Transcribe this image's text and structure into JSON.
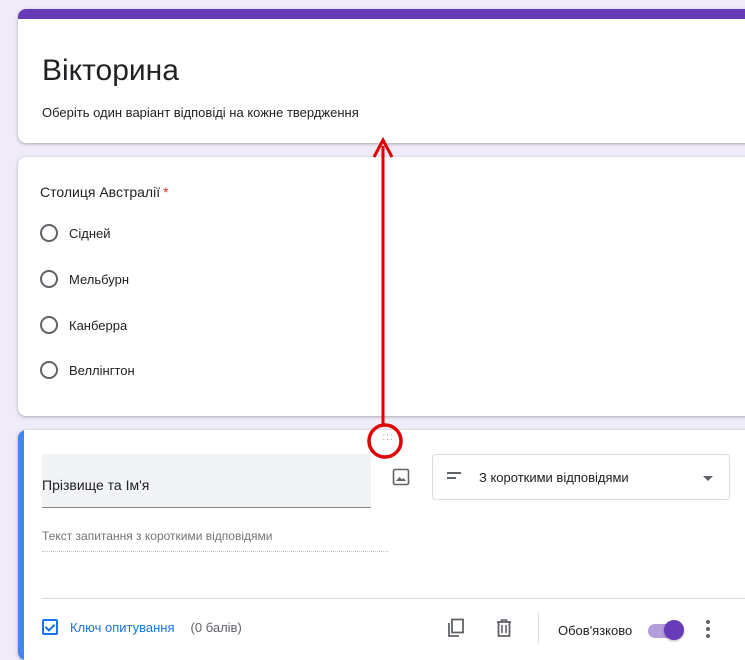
{
  "form": {
    "title": "Вікторина",
    "description": "Оберіть один варіант відповіді на кожне твердження"
  },
  "question": {
    "title": "Столиця Австралії",
    "required_marker": "*",
    "options": [
      "Сідней",
      "Мельбурн",
      "Канберра",
      "Веллінгтон"
    ]
  },
  "edit_question": {
    "title_value": "Прізвище та Ім'я",
    "type_select": "З короткими відповідями",
    "short_answer_placeholder": "Текст запитання з короткими відповідями",
    "answer_key_label": "Ключ опитування",
    "points_label": "(0 балів)",
    "required_label": "Обов'язково",
    "required_on": true,
    "drag_handle": ":::"
  },
  "colors": {
    "theme": "#673ab7",
    "background": "#f0ebf8",
    "edit_accent": "#4285f4",
    "link": "#1a73e8",
    "annotation": "#e00000"
  },
  "icons": [
    "drag-handle-icon",
    "image-icon",
    "short-answer-icon",
    "dropdown-arrow-icon",
    "answer-key-icon",
    "copy-icon",
    "delete-icon",
    "more-icon"
  ]
}
